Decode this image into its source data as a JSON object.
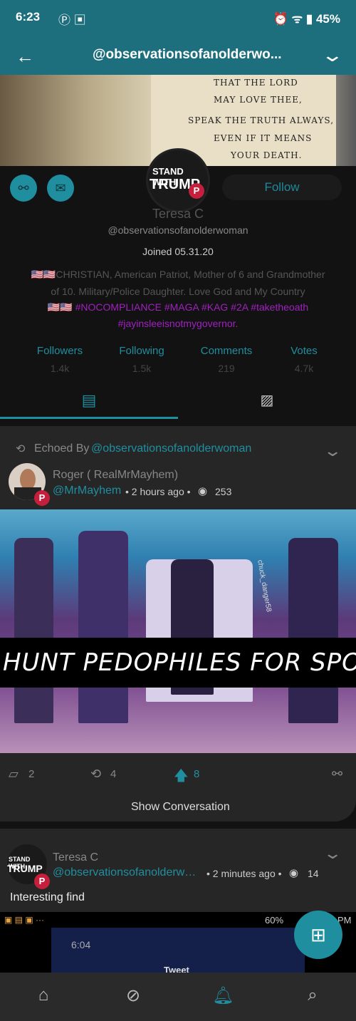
{
  "status_bar": {
    "time": "6:23",
    "battery": "45%"
  },
  "app_bar": {
    "title": "@observationsofanolderwo..."
  },
  "banner": {
    "lines": [
      "THAT THE LORD",
      "MAY LOVE THEE,",
      "SPEAK THE TRUTH ALWAYS,",
      "EVEN IF IT MEANS",
      "YOUR DEATH."
    ]
  },
  "profile": {
    "avatar_text_top": "STAND WITH",
    "avatar_text_bottom": "TRUMP",
    "follow_label": "Follow",
    "name": "Teresa C",
    "handle": "@observationsofanolderwoman",
    "joined": "Joined 05.31.20",
    "bio_line1": "🇺🇸🇺🇸CHRISTIAN, American Patriot, Mother of 6 and Grandmother",
    "bio_line2": "of 10. Military/Police Daughter. Love God and My Country",
    "bio_line3": "🇺🇸🇺🇸 #NOCOMPLIANCE #MAGA #KAG #2A #taketheoath",
    "bio_line4": "#jayinsleeisnotmygovernor."
  },
  "stats": [
    {
      "label": "Followers",
      "value": "1.4k"
    },
    {
      "label": "Following",
      "value": "1.5k"
    },
    {
      "label": "Comments",
      "value": "219"
    },
    {
      "label": "Votes",
      "value": "4.7k"
    }
  ],
  "post1": {
    "echoed_by_prefix": "Echoed By ",
    "echoed_by_handle": "@observationsofanolderwoman",
    "author_name": "Roger ( RealMrMayhem)",
    "author_handle": "@MrMayhem",
    "time": "• 2 hours ago •",
    "views": "253",
    "image_caption": "HUNT PEDOPHILES FOR SPORT",
    "image_watermark": "chuck_danger58",
    "comments": "2",
    "echoes": "4",
    "upvotes": "8",
    "show_conversation": "Show Conversation"
  },
  "post2": {
    "author_name": "Teresa C",
    "author_handle": "@observationsofanolderw…",
    "time": "• 2 minutes ago •",
    "views": "14",
    "text": "Interesting find",
    "embedded_time": "6:04",
    "embedded_status": "60%",
    "embedded_status_right": "PM",
    "embedded_title": "Tweet"
  },
  "colors": {
    "accent": "#1f8fa0",
    "header": "#1d6f7d",
    "parler_red": "#c51f3e"
  }
}
